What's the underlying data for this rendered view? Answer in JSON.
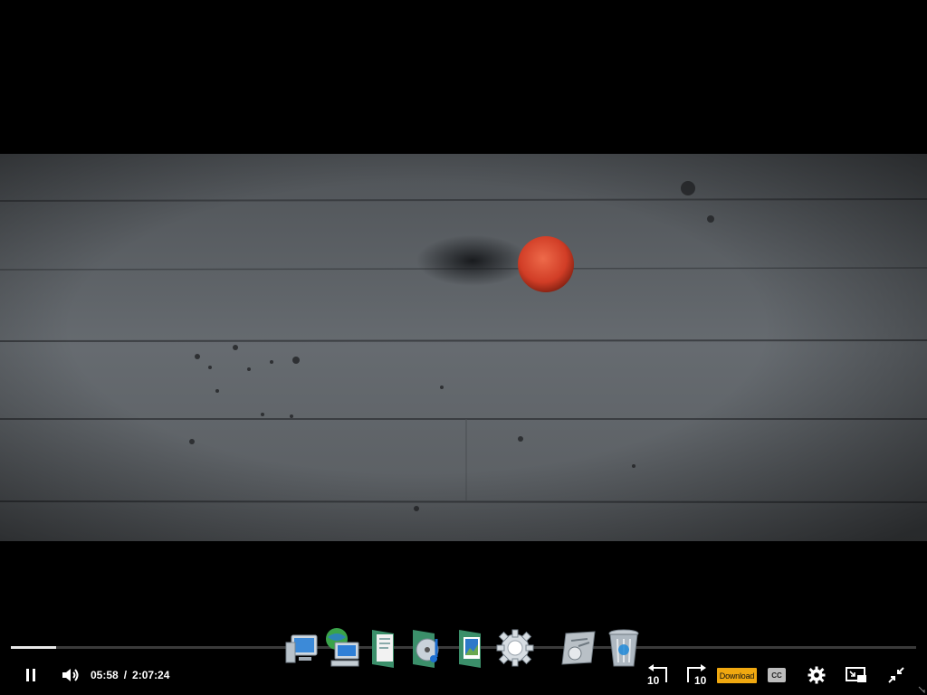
{
  "player": {
    "current_time": "05:58",
    "separator": "/",
    "duration": "2:07:24",
    "progress_played_fraction": 0.05,
    "download_label": "Download",
    "cc_label": "CC",
    "rewind_label": "10",
    "forward_label": "10"
  },
  "icons": {
    "play_pause": "pause-icon",
    "volume": "volume-icon",
    "rewind": "rewind-10-icon",
    "forward": "forward-10-icon",
    "settings": "gear-icon",
    "pip": "picture-in-picture-icon",
    "exit_fullscreen": "exit-fullscreen-icon"
  },
  "dock": {
    "items": [
      {
        "name": "computer-icon"
      },
      {
        "name": "network-icon"
      },
      {
        "name": "documents-folder-icon"
      },
      {
        "name": "music-folder-icon"
      },
      {
        "name": "pictures-folder-icon"
      },
      {
        "name": "settings-gear-icon"
      },
      {
        "name": "disk-utility-icon"
      },
      {
        "name": "recycle-bin-icon"
      }
    ]
  },
  "colors": {
    "accent_download": "#f0a810",
    "ball": "#d9472e",
    "floor": "#6e7378"
  }
}
